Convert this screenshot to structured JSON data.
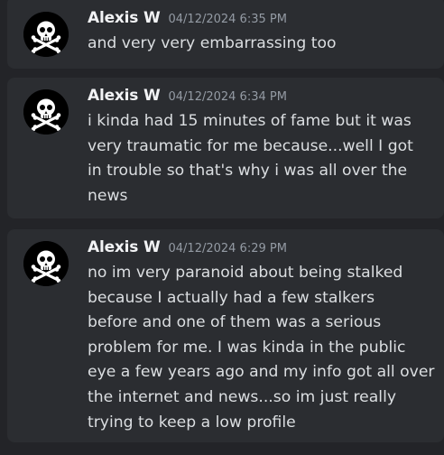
{
  "messages": [
    {
      "author": "Alexis W",
      "timestamp": "04/12/2024 6:35 PM",
      "avatar_icon": "skull-crossbones-icon",
      "lines": [
        "and very very embarrassing too"
      ]
    },
    {
      "author": "Alexis W",
      "timestamp": "04/12/2024 6:34 PM",
      "avatar_icon": "skull-crossbones-icon",
      "lines": [
        "i kinda had 15 minutes of fame but it was",
        "very traumatic for me because...well I got",
        "in trouble so that's why i was all over the",
        "news"
      ]
    },
    {
      "author": "Alexis W",
      "timestamp": "04/12/2024 6:29 PM",
      "avatar_icon": "skull-crossbones-icon",
      "lines": [
        "no im very paranoid about being stalked",
        "because I actually had a few stalkers",
        "before and one of them was a serious",
        "problem for me. I was kinda in the public",
        "eye a few years ago and my info got all over",
        "the internet and news...so im just really",
        "trying to keep a low profile"
      ]
    }
  ],
  "colors": {
    "background": "#232428",
    "card": "#2b2d31",
    "author": "#f2f3f5",
    "timestamp": "#949ba4",
    "body_text": "#dbdee1"
  }
}
